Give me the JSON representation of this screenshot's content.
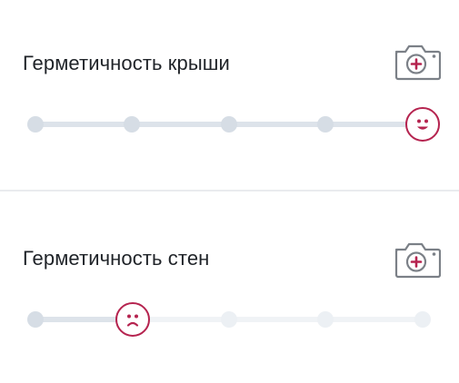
{
  "sections": [
    {
      "title": "Герметичность крыши",
      "rating": {
        "value": 5,
        "max": 5,
        "face": "happy-face-icon"
      }
    },
    {
      "title": "Герметичность стен",
      "rating": {
        "value": 2,
        "max": 5,
        "face": "sad-face-icon"
      }
    }
  ],
  "icons": {
    "camera": "camera-add-icon"
  },
  "colors": {
    "accent": "#b5234f",
    "track_active": "#dde3ea",
    "track_inactive": "#f0f3f6",
    "dot_active": "#d6dde5",
    "dot_inactive": "#ecf0f4",
    "icon_gray": "#7b8087",
    "title": "#1f2328"
  }
}
